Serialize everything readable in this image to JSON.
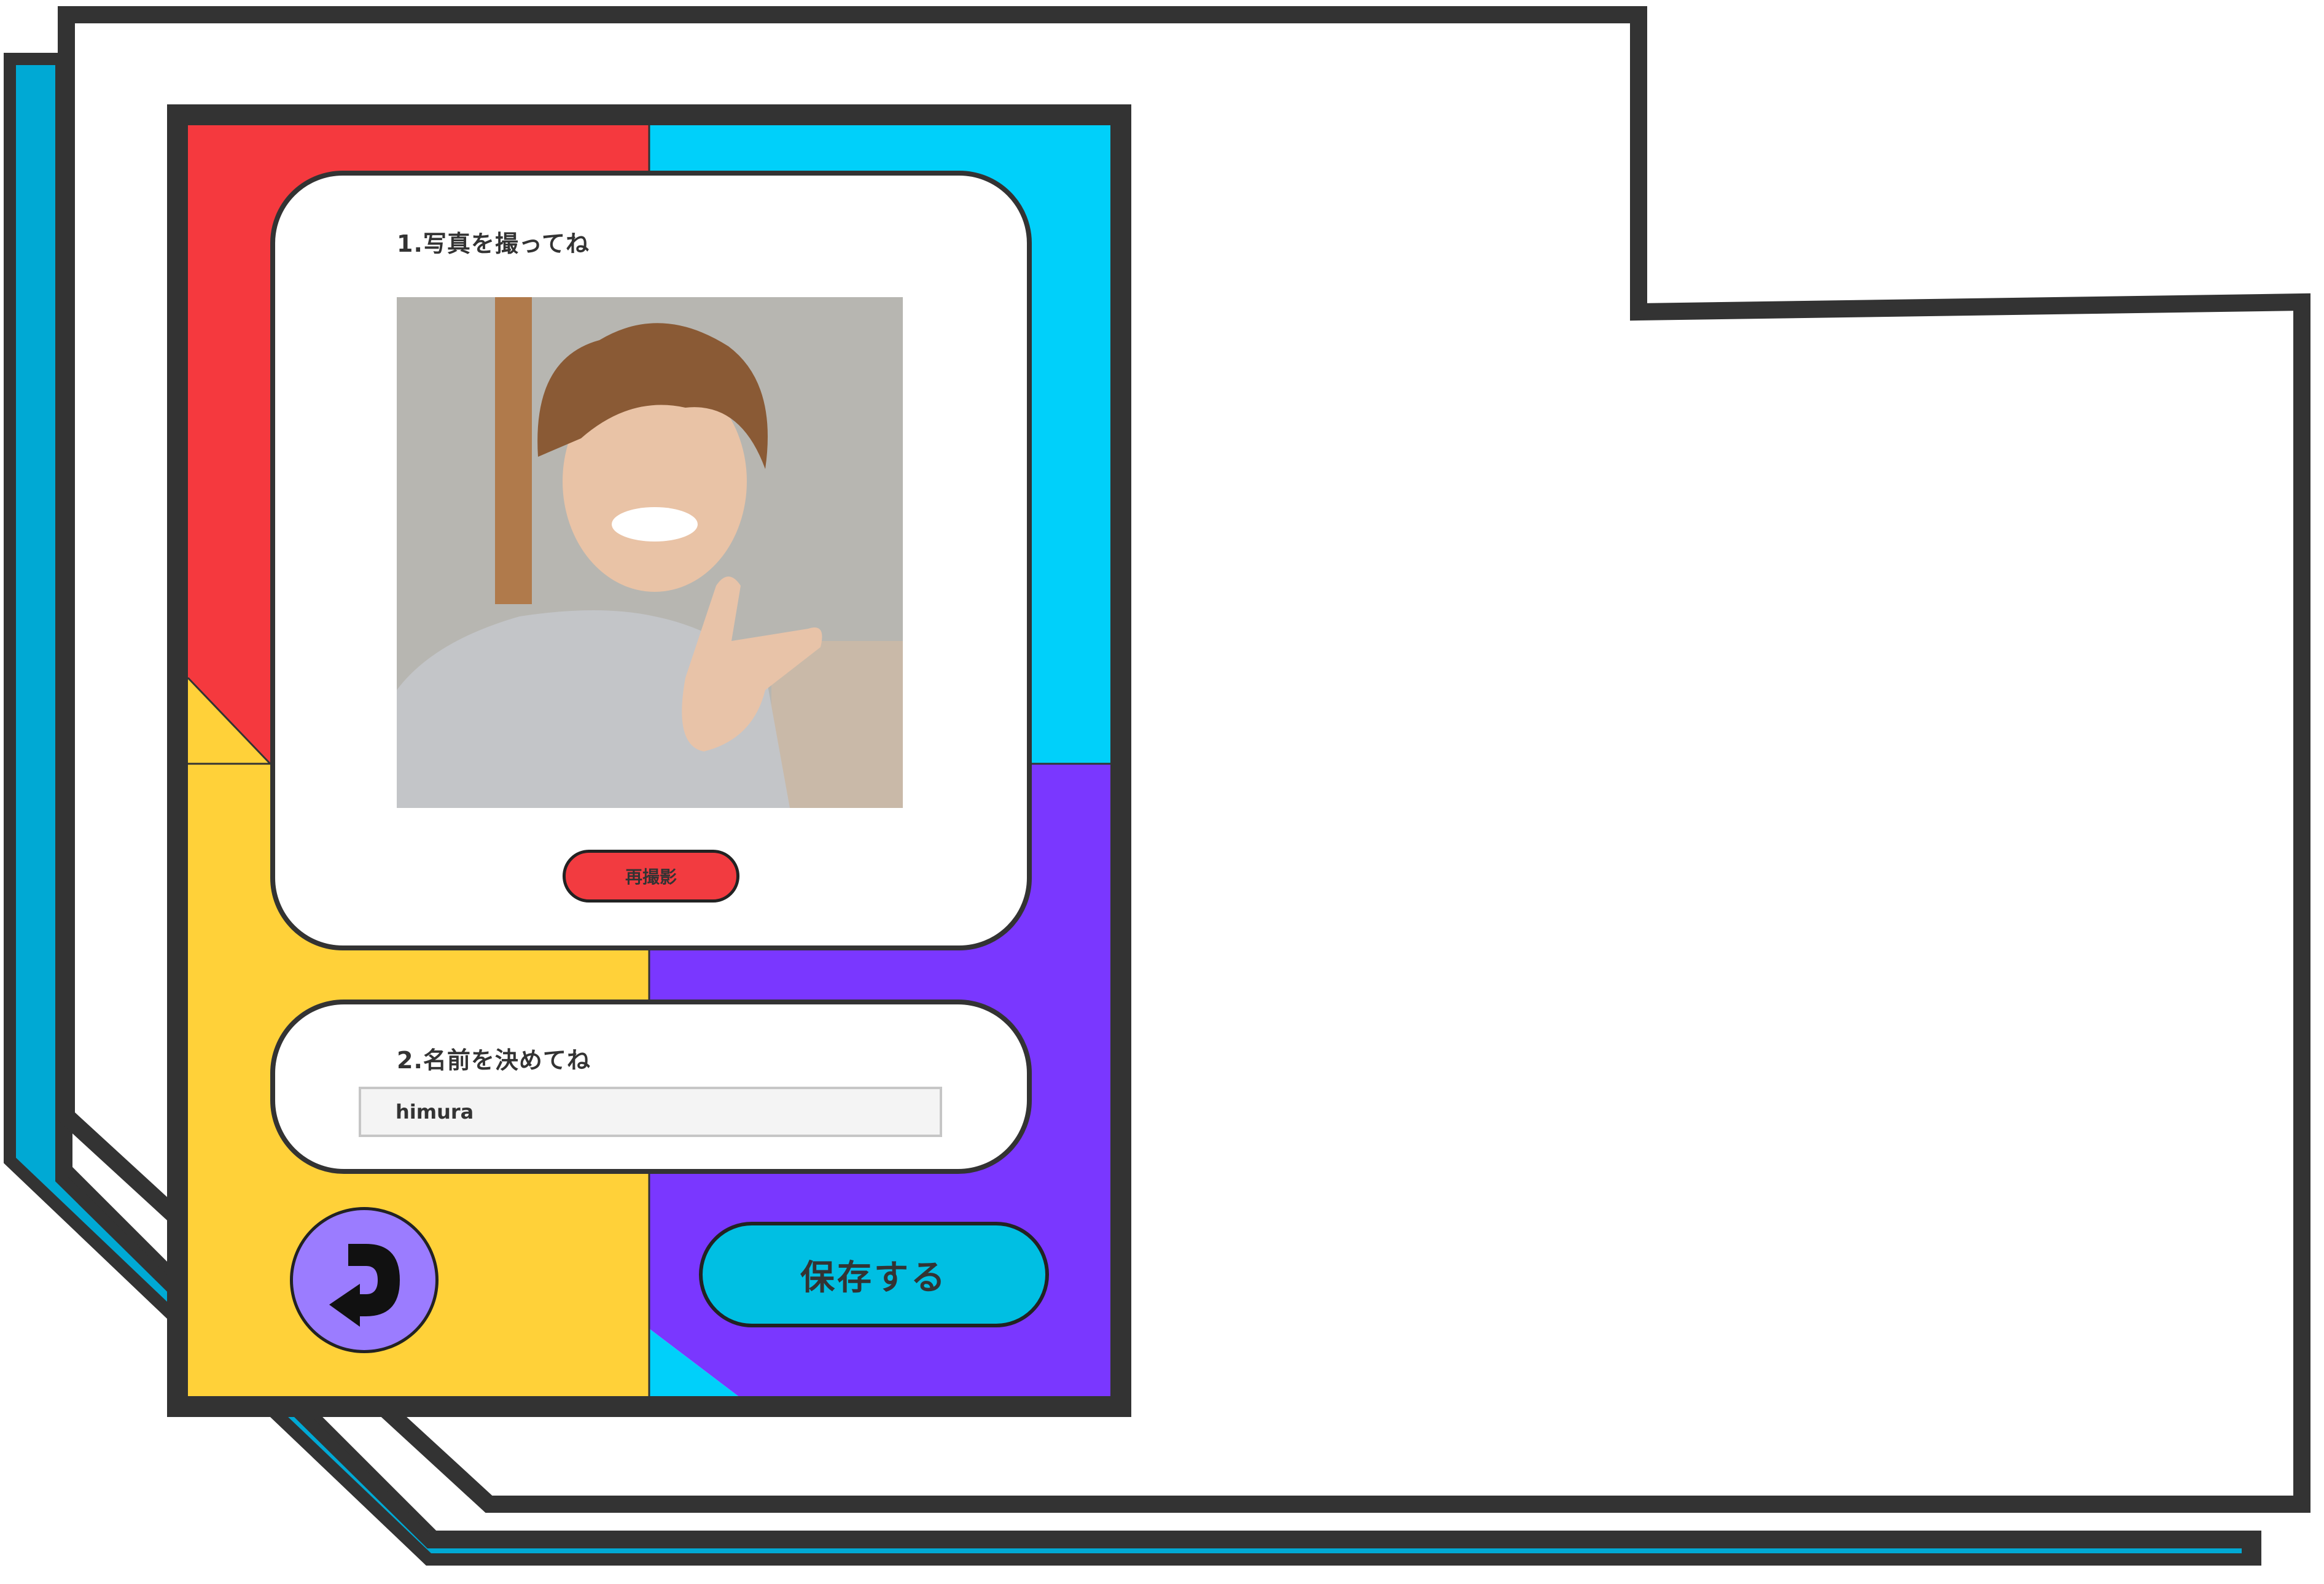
{
  "colors": {
    "outline": "#333333",
    "red": "#f5393e",
    "cyan": "#00d0fa",
    "yellow": "#ffd139",
    "purple": "#7a37ff",
    "shadow_blue": "#00a9d4",
    "retake_red": "#f23b40",
    "save_cyan": "#00bfe3",
    "back_purple": "#9b7cff"
  },
  "photo_step": {
    "title": "1.写真を撮ってね",
    "retake_label": "再撮影"
  },
  "name_step": {
    "title": "2.名前を決めてね",
    "input_value": "himura"
  },
  "actions": {
    "back_icon": "undo-arrow-icon",
    "save_label": "保存する"
  }
}
